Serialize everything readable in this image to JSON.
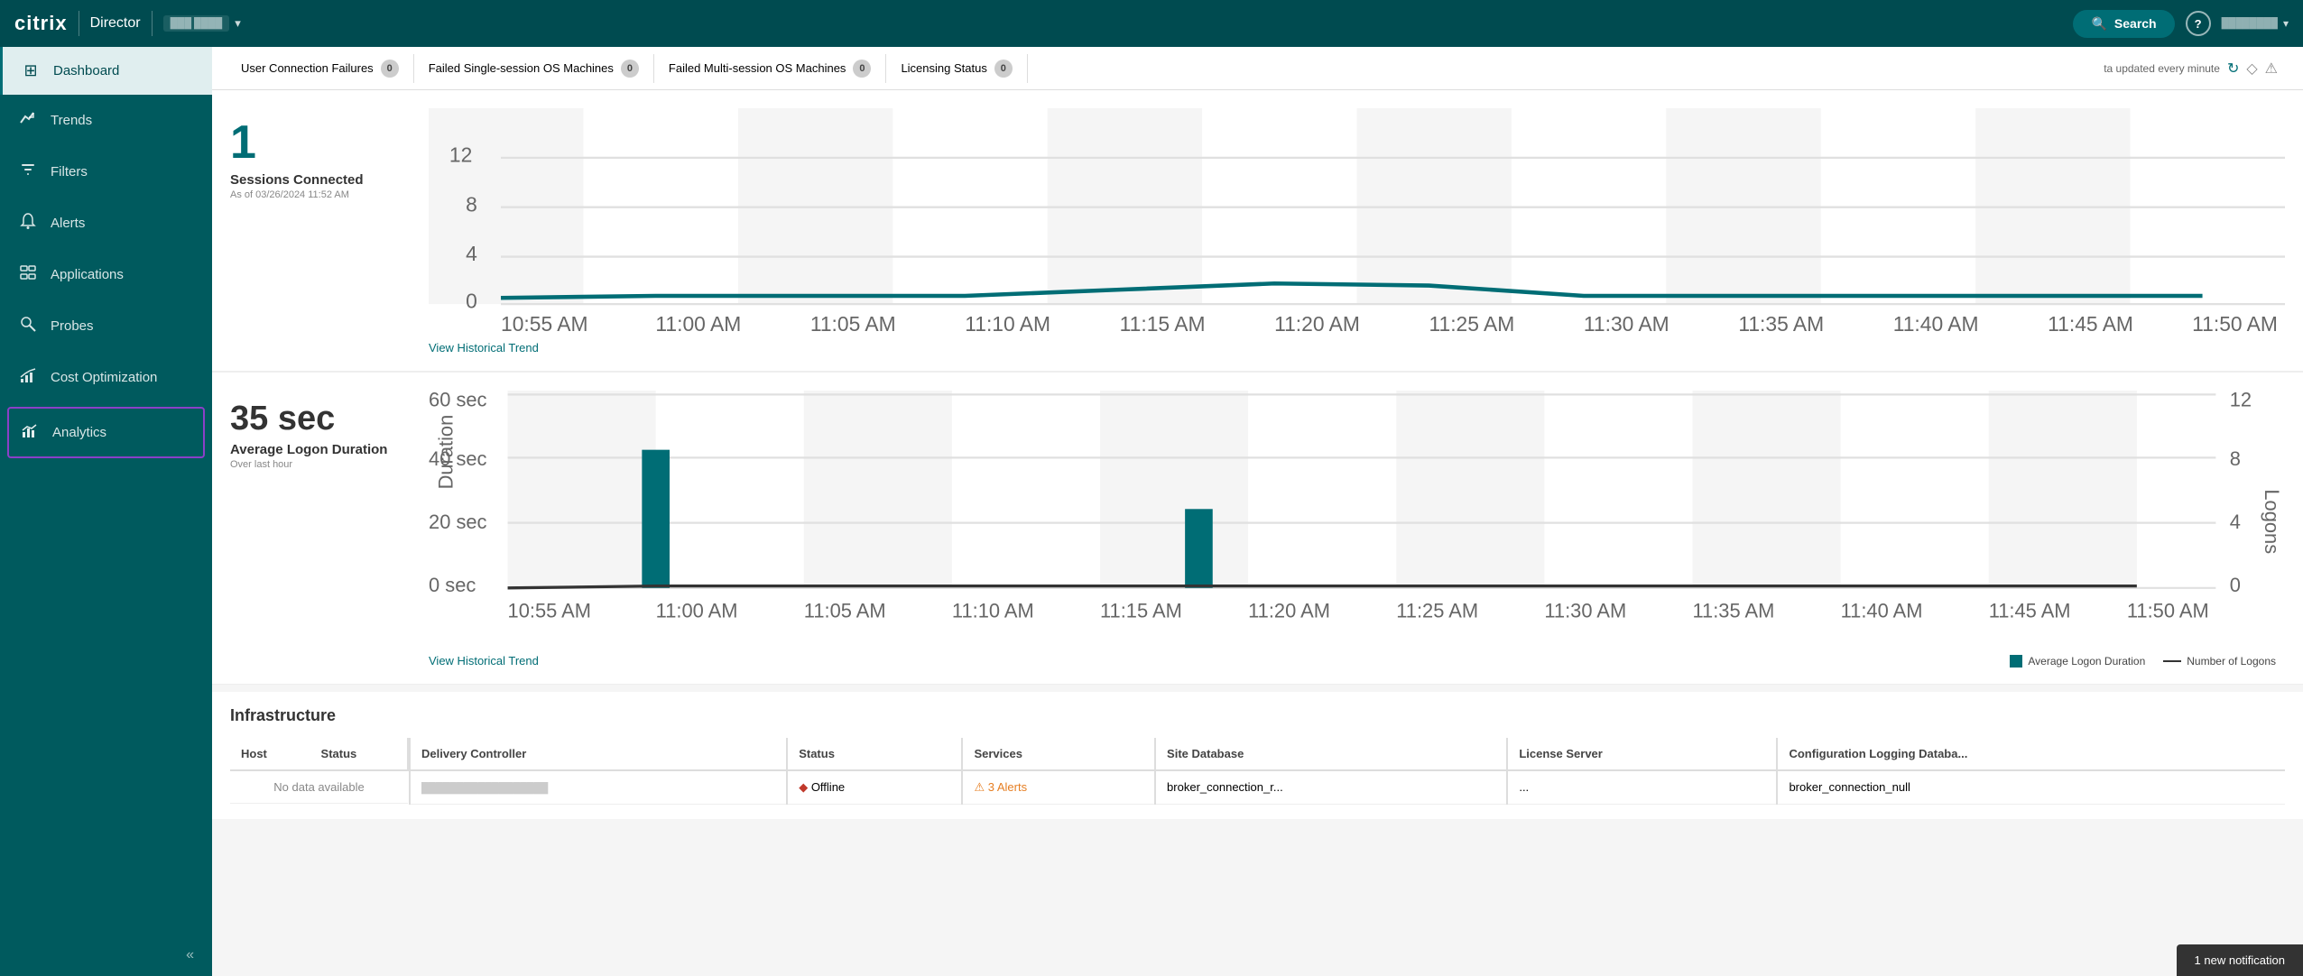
{
  "topnav": {
    "logo": "citrix",
    "app_name": "Director",
    "site_label": "Site Name",
    "chevron": "▾",
    "search_label": "Search",
    "help_label": "?",
    "user_label": "username",
    "user_chevron": "▾"
  },
  "sidebar": {
    "items": [
      {
        "id": "dashboard",
        "label": "Dashboard",
        "icon": "⊞"
      },
      {
        "id": "trends",
        "label": "Trends",
        "icon": "📈"
      },
      {
        "id": "filters",
        "label": "Filters",
        "icon": "⚙"
      },
      {
        "id": "alerts",
        "label": "Alerts",
        "icon": "🔔"
      },
      {
        "id": "applications",
        "label": "Applications",
        "icon": "🗂"
      },
      {
        "id": "probes",
        "label": "Probes",
        "icon": "🔍"
      },
      {
        "id": "cost-optimization",
        "label": "Cost Optimization",
        "icon": "💹"
      },
      {
        "id": "analytics",
        "label": "Analytics",
        "icon": "📊",
        "active": true
      }
    ],
    "collapse_label": "«"
  },
  "statusbar": {
    "items": [
      {
        "label": "User Connection Failures",
        "count": "0"
      },
      {
        "label": "Failed Single-session OS Machines",
        "count": "0"
      },
      {
        "label": "Failed Multi-session OS Machines",
        "count": "0"
      },
      {
        "label": "Licensing Status",
        "count": "0"
      }
    ],
    "update_text": "ta updated every minute"
  },
  "sessions_chart": {
    "stat_number": "1",
    "stat_label": "Sessions Connected",
    "stat_time": "As of 03/26/2024 11:52 AM",
    "view_trend": "View Historical Trend",
    "x_labels": [
      "10:55 AM",
      "11:00 AM",
      "11:05 AM",
      "11:10 AM",
      "11:15 AM",
      "11:20 AM",
      "11:25 AM",
      "11:30 AM",
      "11:35 AM",
      "11:40 AM",
      "11:45 AM",
      "11:50 AM"
    ],
    "y_labels": [
      "0",
      "4",
      "8",
      "12"
    ]
  },
  "logon_chart": {
    "stat_number": "35 sec",
    "stat_label": "Average Logon Duration",
    "stat_subtext": "Over last hour",
    "view_trend": "View Historical Trend",
    "x_labels": [
      "10:55 AM",
      "11:00 AM",
      "11:05 AM",
      "11:10 AM",
      "11:15 AM",
      "11:20 AM",
      "11:25 AM",
      "11:30 AM",
      "11:35 AM",
      "11:40 AM",
      "11:45 AM",
      "11:50 AM"
    ],
    "y_labels_left": [
      "0 sec",
      "20 sec",
      "40 sec",
      "60 sec"
    ],
    "y_labels_right": [
      "0",
      "4",
      "8",
      "12"
    ],
    "legend_bar": "Average Logon Duration",
    "legend_line": "Number of Logons"
  },
  "infrastructure": {
    "title": "Infrastructure",
    "host_columns": [
      "Host",
      "Status"
    ],
    "dc_columns": [
      "Delivery Controller",
      "Status",
      "Services",
      "Site Database",
      "License Server",
      "Configuration Logging Databa..."
    ],
    "no_host_data": "No data available",
    "dc_rows": [
      {
        "controller": "dc-name-redacted",
        "status": "Offline",
        "services_text": "3 Alerts",
        "site_db": "broker_connection_r...",
        "license_server": "...",
        "config_logging": "broker_connection_null"
      }
    ]
  },
  "notification": {
    "text": "1 new notification"
  }
}
